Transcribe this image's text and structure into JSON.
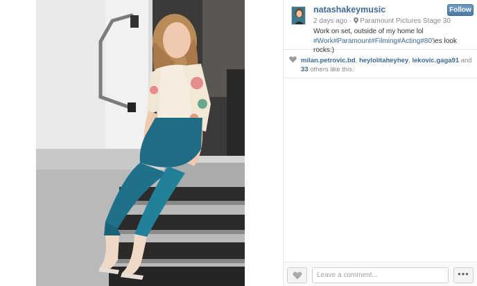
{
  "post": {
    "username": "natashakeymusic",
    "follow_label": "Follow",
    "time_ago": "2 days ago",
    "separator": "·",
    "location": "Paramount Pictures Stage 30",
    "caption_text": "Work on set, outside of my home lol",
    "hashtags": [
      "#Work",
      "#Paramount",
      "#Filming",
      "#Acting",
      "#80"
    ],
    "caption_tail": "'ies look rocks:)"
  },
  "likes": {
    "users": [
      "milan.petrovic.bd",
      "heylolitaheyhey",
      "lekovic.gaga91"
    ],
    "and_label": "and",
    "others_count": "33",
    "others_suffix": "others like this."
  },
  "footer": {
    "comment_placeholder": "Leave a comment...",
    "more_label": "•••"
  },
  "colors": {
    "link": "#3d6a93",
    "follow_button": "#4d7aa6",
    "muted_text": "#8a8a8a",
    "pants": "#1e6d85"
  },
  "icons": {
    "location": "location-pin-icon",
    "like_indicator": "heart-icon",
    "like_button": "heart-icon",
    "more": "more-options-icon"
  }
}
